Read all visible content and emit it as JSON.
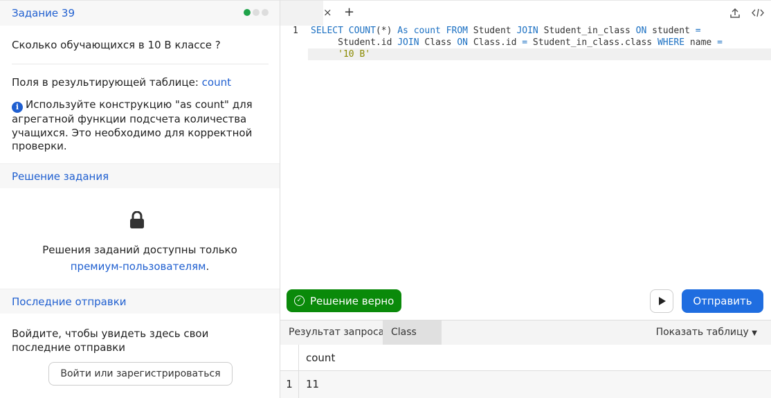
{
  "task": {
    "title": "Задание 39",
    "progress_dots": [
      "#1fa34a",
      "#dddddd",
      "#dddddd"
    ],
    "question": "Сколько обучающихся в 10 В классе ?",
    "fields_label": "Поля в результирующей таблице:",
    "fields_value": "count",
    "info_icon": "info-icon",
    "info_text": "Используйте конструкцию \"as count\" для агрегатной функции подсчета количества учащихся. Это необходимо для корректной проверки."
  },
  "solution": {
    "header": "Решение задания",
    "lock_icon": "lock-icon",
    "text": "Решения заданий доступны только",
    "link": "премиум-пользователям",
    "suffix": "."
  },
  "submissions": {
    "header": "Последние отправки",
    "text": "Войдите, чтобы увидеть здесь свои последние отправки",
    "login_button": "Войти или зарегистрироваться"
  },
  "editor": {
    "close": "×",
    "add": "+",
    "line_number": "1",
    "code_lines": [
      [
        [
          "kw",
          "SELECT COUNT"
        ],
        [
          "",
          "(*) "
        ],
        [
          "kw",
          "As count FROM"
        ],
        [
          "",
          " Student "
        ],
        [
          "kw",
          "JOIN"
        ],
        [
          "",
          " Student_in_class "
        ],
        [
          "kw",
          "ON"
        ],
        [
          "",
          " student "
        ],
        [
          "kw",
          "="
        ]
      ],
      [
        [
          "",
          "     Student.id "
        ],
        [
          "kw",
          "JOIN"
        ],
        [
          "",
          " Class "
        ],
        [
          "kw",
          "ON"
        ],
        [
          "",
          " Class.id "
        ],
        [
          "kw",
          "="
        ],
        [
          "",
          " Student_in_class.class "
        ],
        [
          "kw",
          "WHERE"
        ],
        [
          "",
          " name "
        ],
        [
          "kw",
          "="
        ]
      ],
      [
        [
          "str",
          "     '10 B'"
        ]
      ]
    ]
  },
  "status": {
    "label": "Решение верно",
    "color": "#0a8a0a"
  },
  "actions": {
    "send": "Отправить"
  },
  "result": {
    "tabs": [
      "Результат запроса",
      "Class"
    ],
    "show_table": "Показать таблицу",
    "columns": [
      "count"
    ],
    "rows": [
      {
        "index": "1",
        "values": [
          "11"
        ]
      }
    ]
  }
}
